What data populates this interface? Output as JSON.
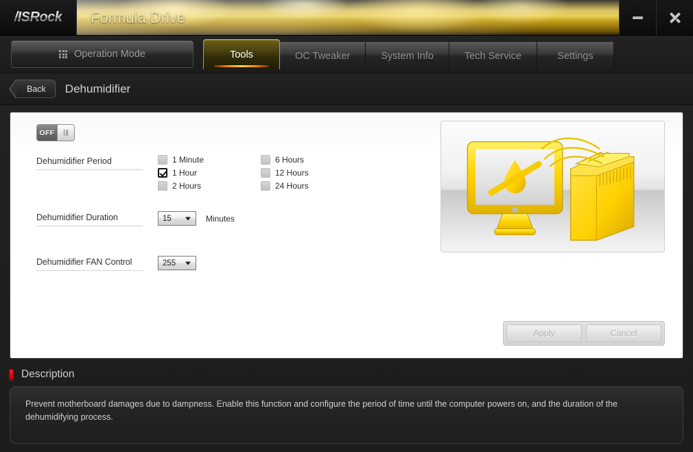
{
  "titlebar": {
    "logo": "/ISRock",
    "app_title": "Formula Drive",
    "minimize_name": "minimize-button",
    "close_name": "close-button"
  },
  "tabbar": {
    "operation_mode": "Operation Mode",
    "tabs": [
      {
        "label": "Tools",
        "active": true
      },
      {
        "label": "OC Tweaker",
        "active": false
      },
      {
        "label": "System Info",
        "active": false
      },
      {
        "label": "Tech Service",
        "active": false
      },
      {
        "label": "Settings",
        "active": false
      }
    ]
  },
  "breadcrumb": {
    "back_label": "Back",
    "page_title": "Dehumidifier"
  },
  "panel": {
    "power_toggle": {
      "state_label": "OFF",
      "enabled": false
    },
    "period": {
      "label": "Dehumidifier Period",
      "options_col1": [
        {
          "label": "1 Minute",
          "checked": false
        },
        {
          "label": "1 Hour",
          "checked": true
        },
        {
          "label": "2 Hours",
          "checked": false
        }
      ],
      "options_col2": [
        {
          "label": "6 Hours",
          "checked": false
        },
        {
          "label": "12 Hours",
          "checked": false
        },
        {
          "label": "24 Hours",
          "checked": false
        }
      ]
    },
    "duration": {
      "label": "Dehumidifier Duration",
      "value": "15",
      "unit": "Minutes"
    },
    "fan_control": {
      "label": "Dehumidifier FAN Control",
      "value": "255"
    },
    "illustration": {
      "name": "dehumidifier-illustration",
      "accent_color": "#ffd800"
    },
    "buttons": {
      "apply": "Apply",
      "cancel": "Cancel",
      "disabled": true
    }
  },
  "description": {
    "title": "Description",
    "text": "Prevent motherboard damages due to dampness. Enable this function and configure the period of time until the computer powers on, and the duration of the dehumidifying process."
  }
}
